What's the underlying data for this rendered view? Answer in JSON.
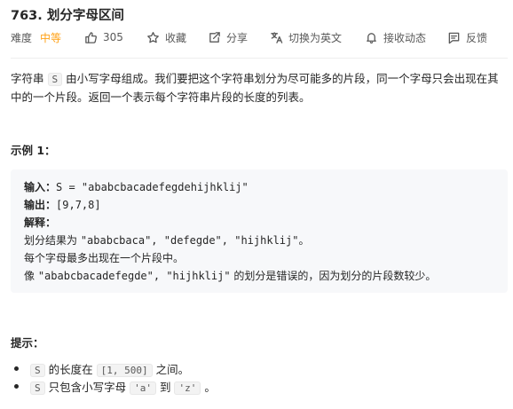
{
  "problem": {
    "title": "763. 划分字母区间",
    "difficulty_label": "难度",
    "difficulty_value": "中等",
    "likes": "305",
    "favorite_label": "收藏",
    "share_label": "分享",
    "switch_lang_label": "切换为英文",
    "notify_label": "接收动态",
    "feedback_label": "反馈"
  },
  "description": {
    "p1_before": "字符串",
    "p1_code": "S",
    "p1_after": "由小写字母组成。我们要把这个字符串划分为尽可能多的片段，同一个字母只会出现在其中的一个片段。返回一个表示每个字符串片段的长度的列表。"
  },
  "example": {
    "title": "示例 1：",
    "input_label": "输入：",
    "input_value": "S = \"ababcbacadefegdehijhklij\"",
    "output_label": "输出：",
    "output_value": "[9,7,8]",
    "explain_label": "解释：",
    "line1_a": "划分结果为 ",
    "line1_b": "\"ababcbaca\", \"defegde\", \"hijhklij\"",
    "line1_c": "。",
    "line2": "每个字母最多出现在一个片段中。",
    "line3_a": "像 ",
    "line3_b": "\"ababcbacadefegde\", \"hijhklij\"",
    "line3_c": " 的划分是错误的，因为划分的片段数较少。"
  },
  "hints": {
    "title": "提示：",
    "h1_code": "S",
    "h1_a": "的长度在",
    "h1_range": "[1, 500]",
    "h1_b": "之间。",
    "h2_code": "S",
    "h2_a": "只包含小写字母",
    "h2_from": "'a'",
    "h2_to_word": "到",
    "h2_to": "'z'",
    "h2_end": "。"
  },
  "colors": {
    "difficulty_medium": "#ffa116",
    "code_block_bg": "#f7f8fa"
  },
  "icons": [
    "thumb-up-icon",
    "star-icon",
    "share-icon",
    "translate-icon",
    "bell-icon",
    "feedback-icon"
  ]
}
